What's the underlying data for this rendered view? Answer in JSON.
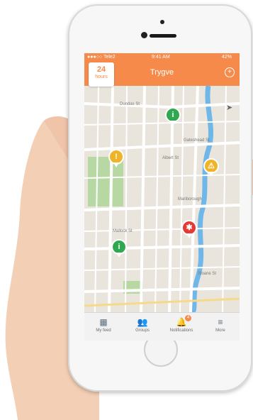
{
  "status": {
    "carrier": "●●●○○ Tele2",
    "time": "9:41 AM",
    "battery": "42%"
  },
  "header": {
    "title": "Trygve"
  },
  "filter": {
    "number": "24",
    "unit": "hours"
  },
  "streets": [
    "Dundas St",
    "Mallock St",
    "Mariborough",
    "Albert St",
    "Gateshead St",
    "Sloane St"
  ],
  "tabs": [
    {
      "label": "My feed"
    },
    {
      "label": "Groups"
    },
    {
      "label": "Notifications",
      "badge": "4"
    },
    {
      "label": "More"
    }
  ],
  "colors": {
    "accent": "#f58a4b",
    "info_pin": "#2fa84f",
    "warning_pin": "#f0b429",
    "alert_pin": "#e53935",
    "water": "#6fb6e9",
    "park": "#b7d8a3"
  }
}
